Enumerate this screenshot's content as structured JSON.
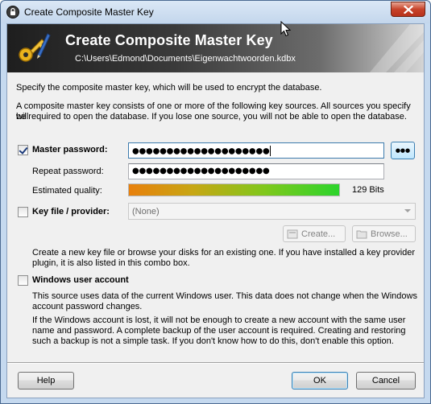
{
  "window": {
    "title": "Create Composite Master Key",
    "close_symbol": "✕"
  },
  "banner": {
    "title": "Create Composite Master Key",
    "path": "C:\\Users\\Edmond\\Documents\\Eigenwachtwoorden.kdbx",
    "icon": "key-pen-icon"
  },
  "intro": {
    "line1": "Specify the composite master key, which will be used to encrypt the database.",
    "line2a": "A composite master key consists of one or more of the following key sources. All sources you specify will",
    "line2b": "be required to open the database.  If you lose one source, you will not be able to open the database."
  },
  "master_password": {
    "checked": true,
    "label": "Master password:",
    "value": "●●●●●●●●●●●●●●●●●●●●",
    "toggle_label": "●●●",
    "repeat_label": "Repeat password:",
    "repeat_value": "●●●●●●●●●●●●●●●●●●●●",
    "quality_label": "Estimated quality:",
    "quality_fraction": 1.0,
    "quality_value": "129 Bits"
  },
  "key_file": {
    "checked": false,
    "label": "Key file / provider:",
    "selected": "(None)",
    "create_label": "Create...",
    "browse_label": "Browse...",
    "help_a": "Create a new key file or browse your disks for an existing one. If you have installed a key provider",
    "help_b": "plugin, it is also listed in this combo box."
  },
  "windows_account": {
    "checked": false,
    "label": "Windows user account",
    "desc1a": "This source uses data of the current Windows user. This data does not change when the Windows",
    "desc1b": "account password changes.",
    "desc2a": "If the Windows account is lost, it will not be enough to create a new account with the same user",
    "desc2b": "name and password. A complete backup of the user account is required. Creating and restoring",
    "desc2c": "such a backup is not a simple task.  If you don't know how to do this, don't enable this option."
  },
  "footer": {
    "help_label": "Help",
    "ok_label": "OK",
    "cancel_label": "Cancel"
  },
  "colors": {
    "banner_dark": "#1e1e1e",
    "default_button_border": "#3c7fb1",
    "close_red": "#c7432a"
  }
}
